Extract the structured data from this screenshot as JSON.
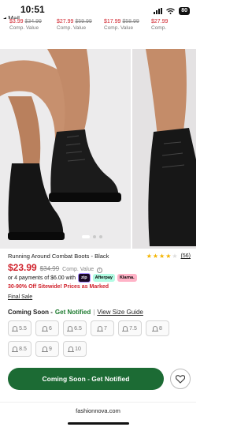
{
  "status_bar": {
    "time": "10:51",
    "back_label": "◂ Mail",
    "battery": "80"
  },
  "recommendations": [
    {
      "price": "$3.99",
      "old_price": "$34.99",
      "label": "Comp. Value"
    },
    {
      "price": "$27.99",
      "old_price": "$59.99",
      "label": "Comp. Value"
    },
    {
      "price": "$17.99",
      "old_price": "$58.99",
      "label": "Comp. Value"
    },
    {
      "price": "$27.99",
      "old_price": "",
      "label": "Comp."
    }
  ],
  "gallery": {
    "slide_count": 3,
    "active_index": 0
  },
  "product": {
    "title": "Running Around Combat Boots - Black",
    "rating": 4.5,
    "review_count": "(56)",
    "price": "$23.99",
    "old_price": "$34.99",
    "comp_label": "Comp. Value",
    "info_icon": "i",
    "installments_text": "or 4 payments of $6.00 with",
    "pay_methods": [
      "zip",
      "Afterpay",
      "Klarna."
    ],
    "promo": "30-90% Off Sitewide! Prices as Marked",
    "final_sale": "Final Sale"
  },
  "availability": {
    "label": "Coming Soon -",
    "notify": "Get Notified",
    "separator": "|",
    "size_guide": "View Size Guide"
  },
  "sizes": [
    "5.5",
    "6",
    "6.5",
    "7",
    "7.5",
    "8",
    "8.5",
    "9",
    "10"
  ],
  "cta": {
    "label": "Coming Soon - Get Notified"
  },
  "browser": {
    "url": "fashionnova.com"
  },
  "colors": {
    "accent_green": "#1c6b34",
    "price_red": "#d0212b",
    "star": "#f4b400"
  }
}
